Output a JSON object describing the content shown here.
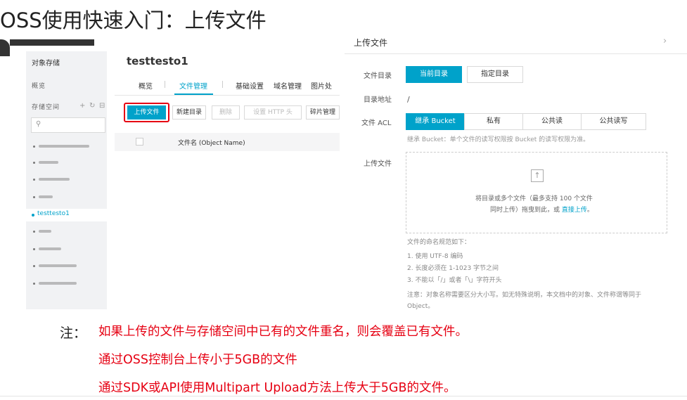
{
  "slide": {
    "title": "OSS使用快速入门：上传文件"
  },
  "console": {
    "sidebar": {
      "header": "对象存储",
      "overview": "概览",
      "buckets_label": "存储空间",
      "add_icon": "+",
      "refresh_icon": "↻",
      "collapse_icon": "⊟",
      "search_icon": "🔍",
      "selected_bucket": "testtesto1"
    },
    "bucket_name": "testtesto1",
    "tabs": [
      "概览",
      "文件管理",
      "基础设置",
      "域名管理",
      "图片处"
    ],
    "toolbar": {
      "upload": "上传文件",
      "new_dir": "新建目录",
      "delete": "删除",
      "http_header": "设置 HTTP 头",
      "fragments": "碎片管理"
    },
    "table": {
      "col_name": "文件名 (Object Name)"
    }
  },
  "drawer": {
    "title": "上传文件",
    "close": "›",
    "file_dir_label": "文件目录",
    "dir_options": [
      "当前目录",
      "指定目录"
    ],
    "dir_addr_label": "目录地址",
    "dir_addr_value": "/",
    "acl_label": "文件 ACL",
    "acl_options": [
      "继承 Bucket",
      "私有",
      "公共读",
      "公共读写"
    ],
    "acl_note": "继承 Bucket：单个文件的读写权限按 Bucket 的读写权限为准。",
    "upload_label": "上传文件",
    "drop_text_1": "将目录或多个文件（最多支持 100 个文件",
    "drop_text_2_prefix": "同时上传）拖曳到此，或 ",
    "drop_text_2_link": "直接上传",
    "drop_text_2_suffix": "。",
    "rules_title": "文件的命名规范如下：",
    "rules": [
      "1. 使用 UTF-8 编码",
      "2. 长度必须在 1-1023 字节之间",
      "3. 不能以「/」或者「\\」字符开头"
    ],
    "caution_1": "注意：对象名称需要区分大小写。如无特殊说明，本文档中的对象、文件称谓等同于",
    "caution_2": "Object。"
  },
  "notes": {
    "label": "注：",
    "lines": [
      "如果上传的文件与存储空间中已有的文件重名，则会覆盖已有文件。",
      "通过OSS控制台上传小于5GB的文件",
      "通过SDK或API使用Multipart Upload方法上传大于5GB的文件。"
    ]
  }
}
